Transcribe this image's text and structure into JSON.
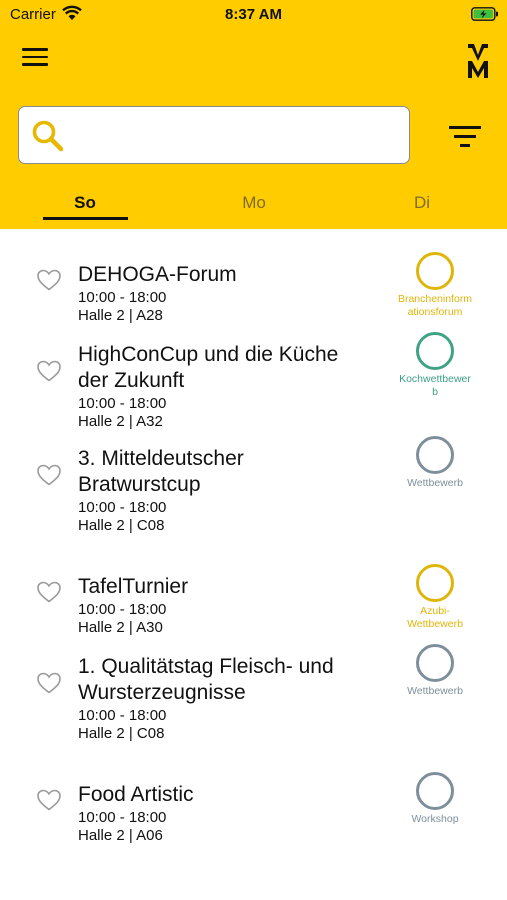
{
  "status_bar": {
    "carrier": "Carrier",
    "time": "8:37 AM"
  },
  "colors": {
    "brand_yellow": "#FFCC00",
    "ring_yellow": "#E0B50A",
    "ring_green": "#3FA285",
    "ring_gray": "#7E8F9A"
  },
  "icons": {
    "menu": "hamburger-icon",
    "logo": "double-m-logo",
    "search": "search-icon",
    "filter": "filter-icon",
    "favorite": "heart-outline-icon"
  },
  "search": {
    "placeholder": "",
    "value": ""
  },
  "tabs": [
    {
      "label": "So",
      "active": true
    },
    {
      "label": "Mo",
      "active": false
    },
    {
      "label": "Di",
      "active": false
    }
  ],
  "events": [
    {
      "title_lines": [
        "DEHOGA-Forum"
      ],
      "time": "10:00 - 18:00",
      "location": "Halle 2 | A28",
      "category_lines": [
        "Brancheninform",
        "ationsforum"
      ],
      "category_color": "#E0B50A"
    },
    {
      "title_lines": [
        "HighConCup und die Küche",
        "der Zukunft"
      ],
      "time": "10:00 - 18:00",
      "location": "Halle 2 | A32",
      "category_lines": [
        "Kochwettbewer",
        "b"
      ],
      "category_color": "#3FA285"
    },
    {
      "title_lines": [
        "3. Mitteldeutscher",
        "Bratwurstcup"
      ],
      "time": " 10:00 - 18:00",
      "location": " Halle 2 | C08",
      "category_lines": [
        "Wettbewerb"
      ],
      "category_color": "#7E8F9A"
    },
    {
      "title_lines": [
        "TafelTurnier"
      ],
      "time": "10:00 - 18:00",
      "location": "Halle 2 | A30",
      "category_lines": [
        "Azubi-",
        "Wettbewerb"
      ],
      "category_color": "#E0B50A"
    },
    {
      "title_lines": [
        "1. Qualitätstag Fleisch- und",
        "Wursterzeugnisse"
      ],
      "time": "10:00 - 18:00",
      "location": "Halle 2 | C08",
      "category_lines": [
        "Wettbewerb"
      ],
      "category_color": "#7E8F9A"
    },
    {
      "title_lines": [
        "Food Artistic"
      ],
      "time": "10:00 - 18:00",
      "location": "Halle 2 | A06",
      "category_lines": [
        "Workshop"
      ],
      "category_color": "#7E8F9A"
    }
  ]
}
